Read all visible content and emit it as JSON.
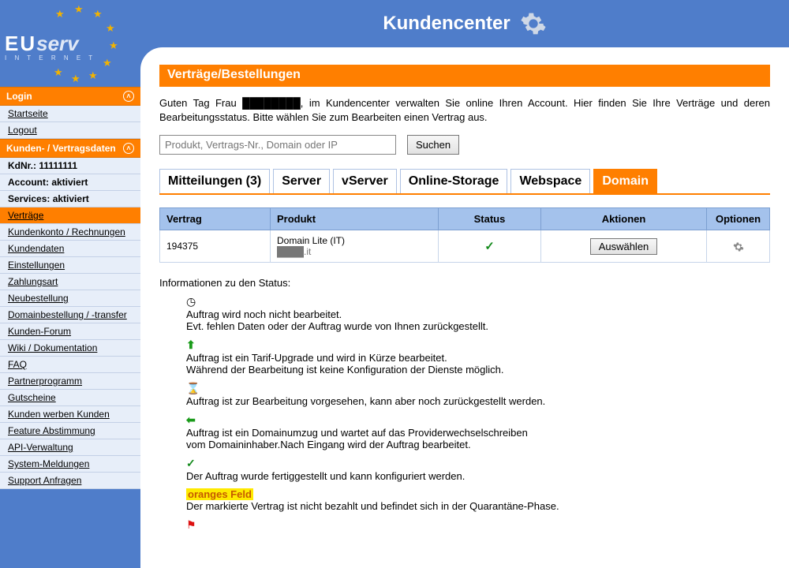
{
  "app_title": "Kundencenter",
  "logo": {
    "eu": "EU",
    "serv": "serv",
    "sub": "I N T E R N E T"
  },
  "sidebar": {
    "login": {
      "header": "Login",
      "items": [
        "Startseite",
        "Logout"
      ]
    },
    "kd": {
      "header": "Kunden- / Vertragsdaten",
      "kdnr": "KdNr.: 11111111",
      "account": "Account: aktiviert",
      "services": "Services: aktiviert",
      "items": [
        "Verträge",
        "Kundenkonto / Rechnungen",
        "Kundendaten",
        "Einstellungen",
        "Zahlungsart",
        "Neubestellung",
        "Domainbestellung / -transfer",
        "Kunden-Forum",
        "Wiki / Dokumentation",
        "FAQ",
        "Partnerprogramm",
        "Gutscheine",
        "Kunden werben Kunden",
        "Feature Abstimmung",
        "API-Verwaltung",
        "System-Meldungen",
        "Support Anfragen"
      ]
    }
  },
  "page_heading": "Verträge/Bestellungen",
  "intro": "Guten Tag Frau ████████, im Kundencenter verwalten Sie online Ihren Account. Hier finden Sie Ihre Verträge und deren Bearbeitungsstatus. Bitte wählen Sie zum Bearbeiten einen Vertrag aus.",
  "search": {
    "placeholder": "Produkt, Vertrags-Nr., Domain oder IP",
    "button": "Suchen"
  },
  "tabs": [
    "Mitteilungen (3)",
    "Server",
    "vServer",
    "Online-Storage",
    "Webspace",
    "Domain"
  ],
  "active_tab_index": 5,
  "table": {
    "headers": {
      "vertrag": "Vertrag",
      "produkt": "Produkt",
      "status": "Status",
      "aktionen": "Aktionen",
      "optionen": "Optionen"
    },
    "row": {
      "vertrag": "194375",
      "produkt_name": "Domain Lite (IT)",
      "produkt_domain": "████.it",
      "action": "Auswählen"
    }
  },
  "status": {
    "heading": "Informationen zu den Status:",
    "items": [
      {
        "icon": "clock",
        "line1": "Auftrag wird noch nicht bearbeitet.",
        "line2": "Evt. fehlen Daten oder der Auftrag wurde von Ihnen zurückgestellt."
      },
      {
        "icon": "up",
        "line1": "Auftrag ist ein Tarif-Upgrade und wird in Kürze bearbeitet.",
        "line2": "Während der Bearbeitung ist keine Konfiguration der Dienste möglich."
      },
      {
        "icon": "hourglass",
        "line1": "Auftrag ist zur Bearbeitung vorgesehen, kann aber noch zurückgestellt werden."
      },
      {
        "icon": "left",
        "line1": "Auftrag ist ein Domainumzug und wartet auf das Providerwechselschreiben",
        "line2": "vom Domaininhaber.Nach Eingang wird der Auftrag bearbeitet."
      },
      {
        "icon": "check",
        "line1": "Der Auftrag wurde fertiggestellt und kann konfiguriert werden."
      },
      {
        "icon": "orange",
        "label": "oranges Feld",
        "line1": "Der markierte Vertrag ist nicht bezahlt und befindet sich in der Quarantäne-Phase."
      },
      {
        "icon": "flag"
      }
    ]
  }
}
